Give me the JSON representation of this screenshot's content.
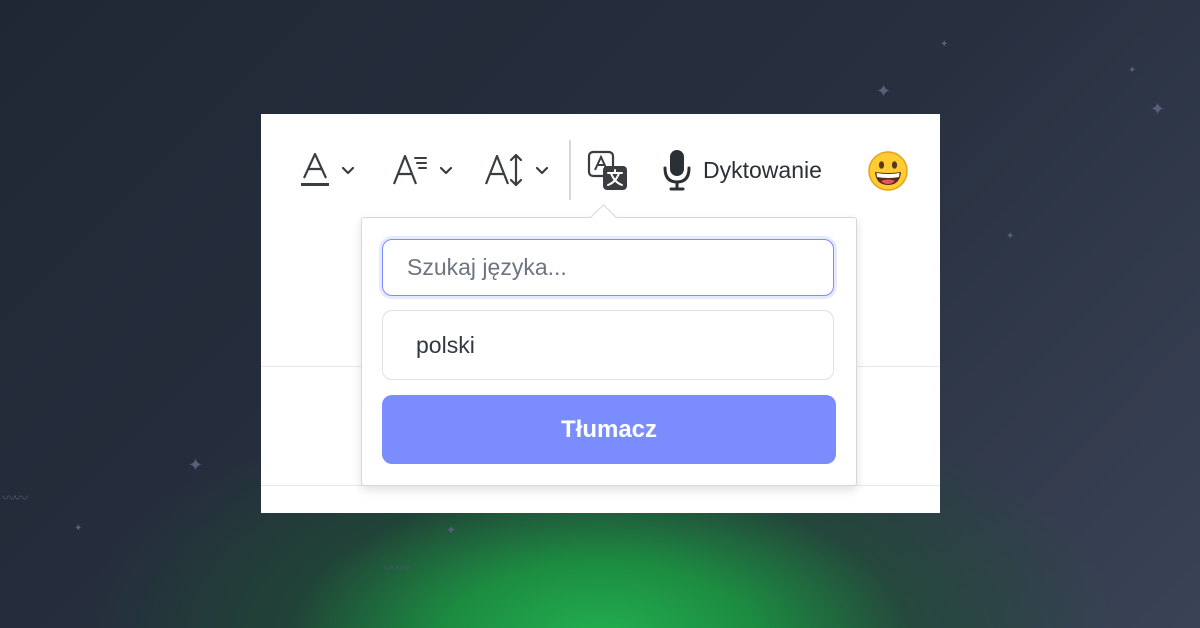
{
  "toolbar": {
    "items": [
      {
        "icon": "text-color-icon"
      },
      {
        "icon": "paragraph-style-icon"
      },
      {
        "icon": "font-size-icon"
      },
      {
        "icon": "translate-icon"
      },
      {
        "icon": "microphone-icon",
        "label": "Dyktowanie"
      },
      {
        "icon": "emoji-icon"
      }
    ]
  },
  "translate_popover": {
    "search_placeholder": "Szukaj języka...",
    "selected_language": "polski",
    "translate_button": "Tłumacz"
  },
  "colors": {
    "accent": "#7b8cff",
    "bg_dark": "#262d3a",
    "glow_green": "#22b04f"
  }
}
